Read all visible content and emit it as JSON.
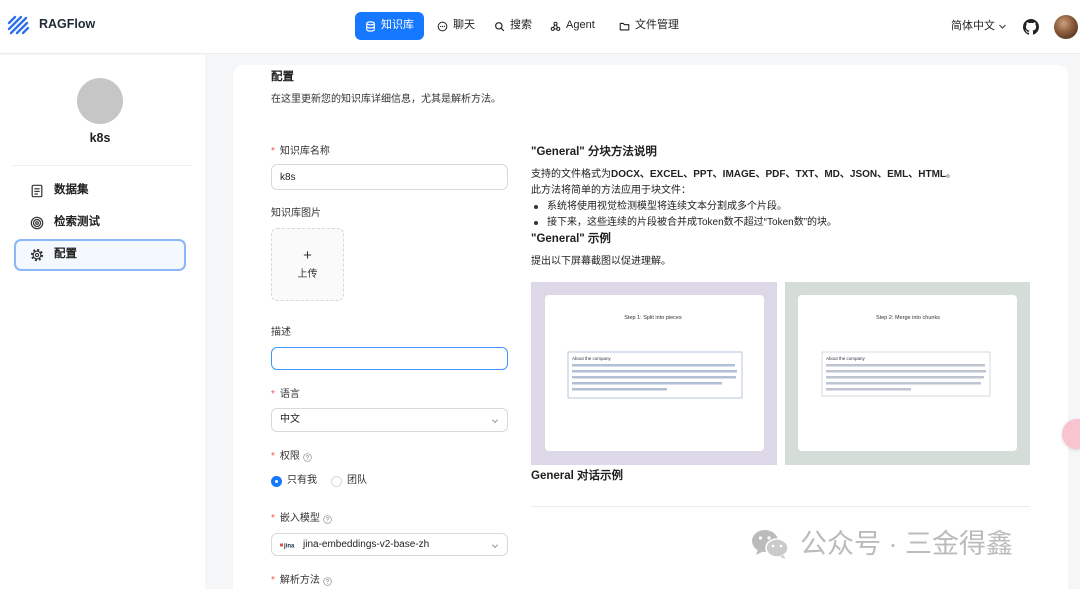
{
  "theme": {
    "primary": "#1677ff",
    "required": "#ff4d4f",
    "example_bg_1": "#dcd8e7",
    "example_bg_2": "#d5ddd8"
  },
  "app": {
    "name": "RAGFlow",
    "logo_icon": "ragflow-logo-icon"
  },
  "nav": {
    "items": [
      {
        "label": "知识库",
        "icon": "database-icon",
        "active": true
      },
      {
        "label": "聊天",
        "icon": "chat-icon",
        "active": false
      },
      {
        "label": "搜索",
        "icon": "search-icon",
        "active": false
      },
      {
        "label": "Agent",
        "icon": "agent-icon",
        "active": false
      },
      {
        "label": "文件管理",
        "icon": "folder-icon",
        "active": false
      }
    ]
  },
  "header": {
    "language": "简体中文",
    "language_icon": "chevron-down-icon",
    "github_icon": "github-icon",
    "avatar": "user-avatar"
  },
  "sidebar": {
    "kb_name": "k8s",
    "items": [
      {
        "label": "数据集",
        "icon": "dataset-icon",
        "active": false
      },
      {
        "label": "检索测试",
        "icon": "retrieval-test-icon",
        "active": false
      },
      {
        "label": "配置",
        "icon": "gear-icon",
        "active": true
      }
    ]
  },
  "config": {
    "title": "配置",
    "subtitle": "在这里更新您的知识库详细信息，尤其是解析方法。",
    "form": {
      "required_mark": "*",
      "name": {
        "label": "知识库名称",
        "value": "k8s",
        "required": true
      },
      "image": {
        "label": "知识库图片",
        "upload_icon": "+",
        "upload_label": "上传"
      },
      "description": {
        "label": "描述"
      },
      "language": {
        "label": "语言",
        "value": "中文",
        "required": true
      },
      "permission": {
        "label": "权限",
        "required": true,
        "help_icon": "question-circle-icon",
        "options": [
          {
            "label": "只有我",
            "checked": true
          },
          {
            "label": "团队",
            "checked": false
          }
        ]
      },
      "embedding_model": {
        "label": "嵌入模型",
        "required": true,
        "value": "jina-embeddings-v2-base-zh",
        "provider_logo": "jina"
      },
      "parser": {
        "label": "解析方法",
        "required": true
      }
    },
    "help": {
      "title": "\"General\" 分块方法说明",
      "formats_prefix": "支持的文件格式为",
      "formats": "DOCX、EXCEL、PPT、IMAGE、PDF、TXT、MD、JSON、EML、HTML",
      "formats_suffix": "。",
      "method": "此方法将简单的方法应用于块文件：",
      "bullets": [
        "系统将使用视觉检测模型将连续文本分割成多个片段。",
        "接下来，这些连续的片段被合并成Token数不超过“Token数”的块。"
      ],
      "example_title": "\"General\" 示例",
      "example_desc": "提出以下屏幕截图以促进理解。",
      "examples": [
        {
          "caption": "Step 1: Split into pieces",
          "section": "About the company"
        },
        {
          "caption": "Step 2: Merge into chunks",
          "section": "About the company"
        }
      ],
      "dialog_title": "General 对话示例"
    }
  },
  "watermark": {
    "icon": "wechat-icon",
    "text": "公众号 · 三金得鑫"
  }
}
